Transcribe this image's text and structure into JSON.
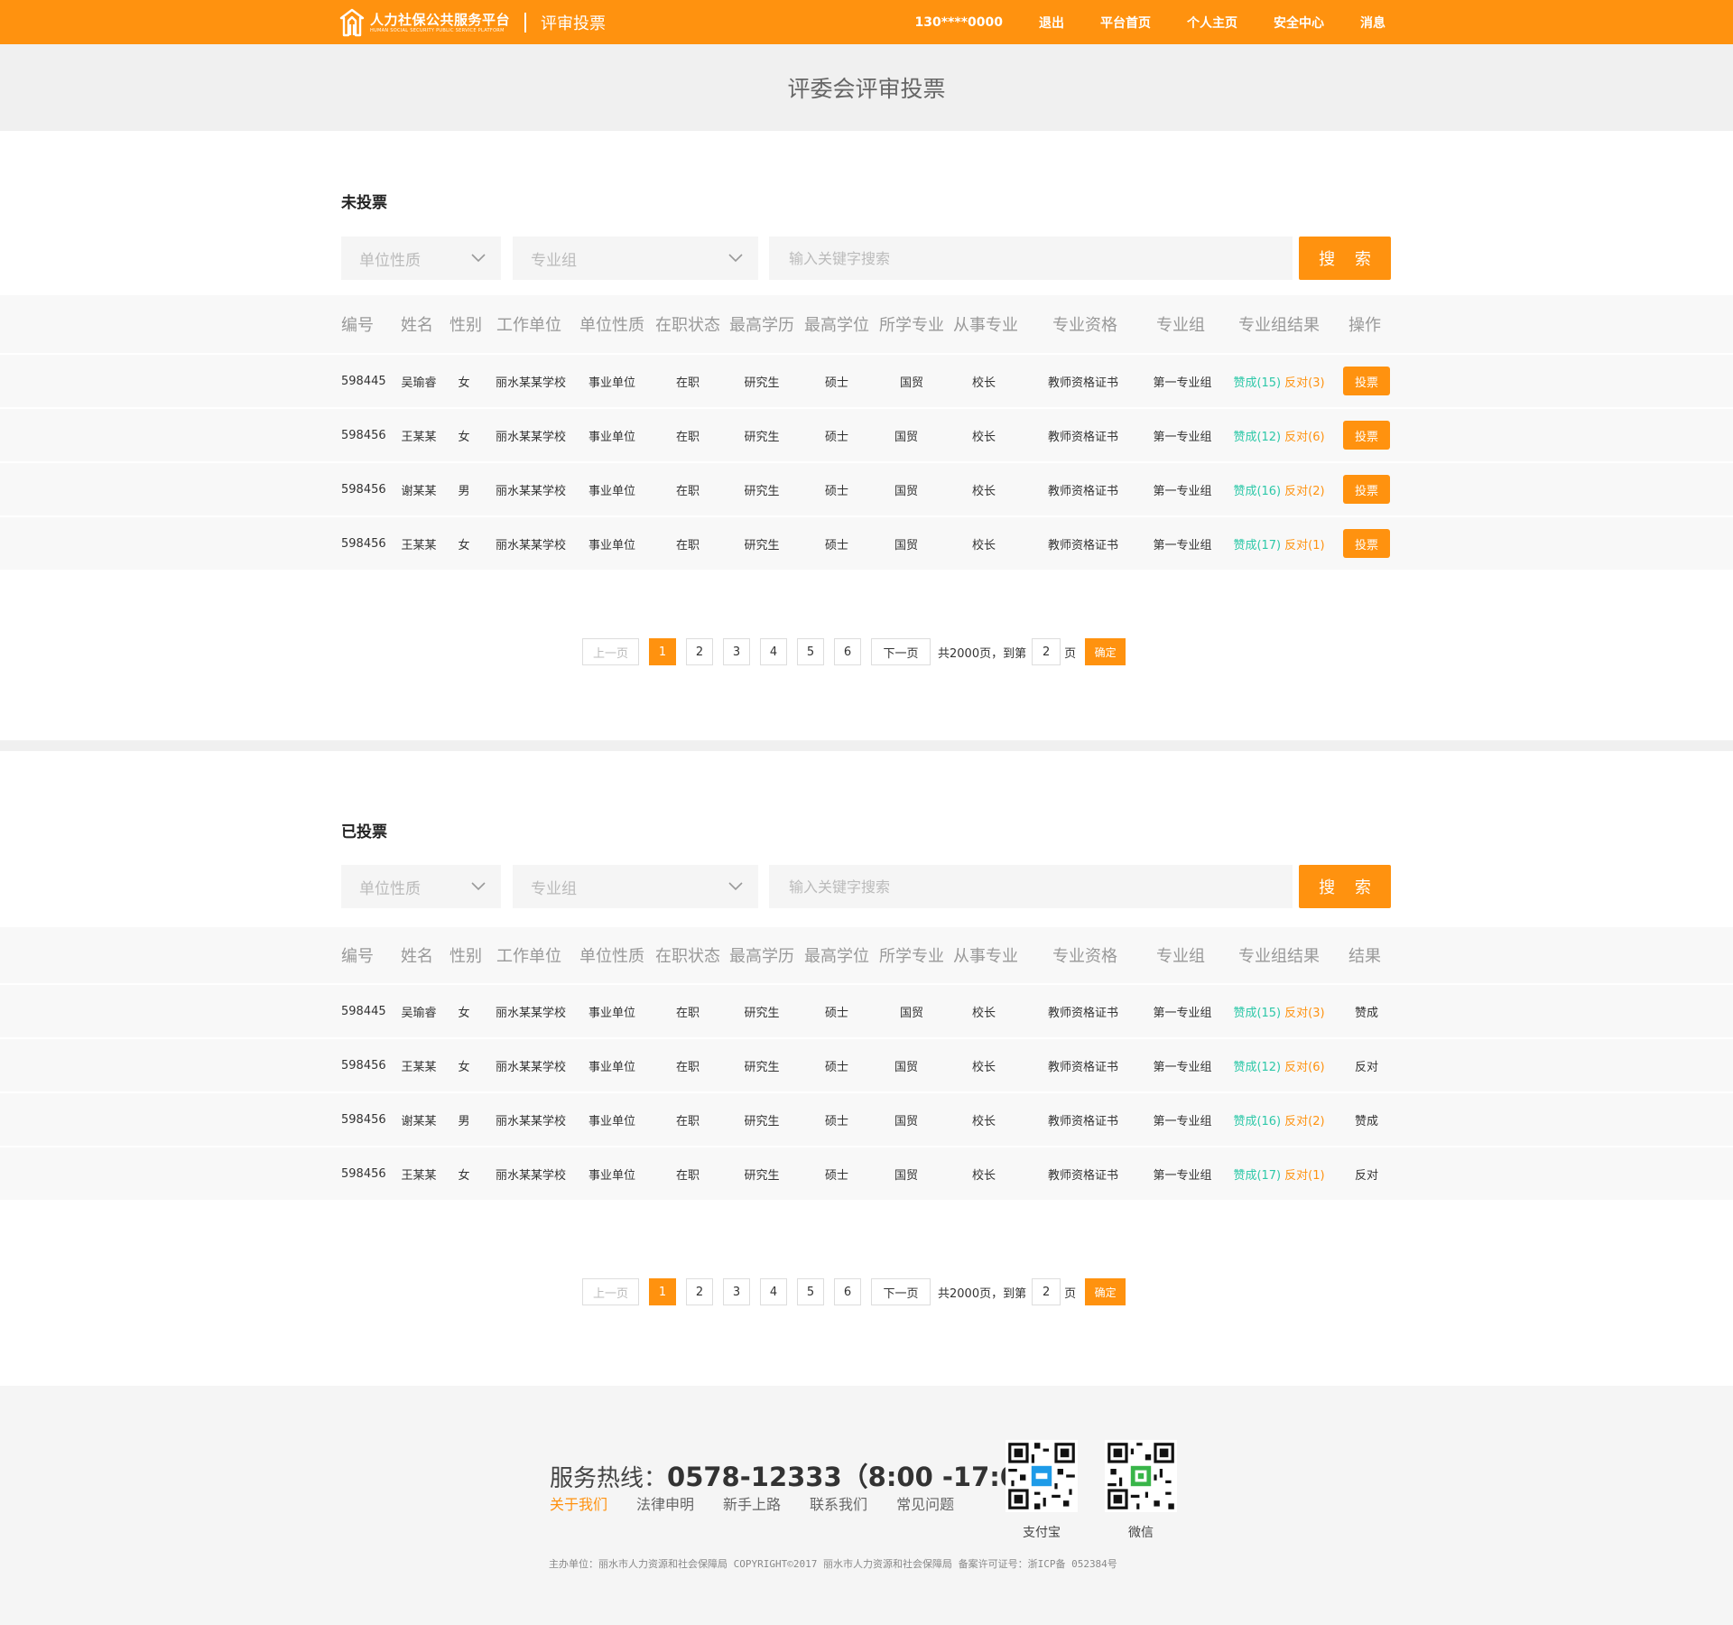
{
  "header": {
    "brand_name": "人力社保公共服务平台",
    "brand_sub": "HUMAN SOCIAL SECURITY PUBLIC SERVICE PLATFORM",
    "page_name": "评审投票",
    "nav": [
      "130****0000",
      "退出",
      "平台首页",
      "个人主页",
      "安全中心",
      "消息"
    ]
  },
  "banner": {
    "title": "评委会评审投票"
  },
  "filters": {
    "unit_type_placeholder": "单位性质",
    "group_placeholder": "专业组",
    "search_placeholder": "输入关键字搜索",
    "search_button": "搜 索"
  },
  "unvoted": {
    "title": "未投票",
    "columns": [
      "编号",
      "姓名",
      "性别",
      "工作单位",
      "单位性质",
      "在职状态",
      "最高学历",
      "最高学位",
      "所学专业",
      "从事专业",
      "专业资格",
      "专业组",
      "专业组结果",
      "操作"
    ],
    "rows": [
      {
        "id": "598445",
        "name": "吴瑜睿",
        "gender": "女",
        "unit": "丽水某某学校",
        "unit_type": "事业单位",
        "status": "在职",
        "education": "研究生",
        "degree": "硕士",
        "major": "国贸",
        "work_major": "校长",
        "qualification": "教师资格证书",
        "group": "第一专业组",
        "agree": "赞成(15)",
        "oppose": "反对(3)",
        "action": "投票"
      },
      {
        "id": "598456",
        "name": "王某某",
        "gender": "女",
        "unit": "丽水某某学校",
        "unit_type": "事业单位",
        "status": "在职",
        "education": "研究生",
        "degree": "硕士",
        "major": "国贸",
        "work_major": "校长",
        "qualification": "教师资格证书",
        "group": "第一专业组",
        "agree": "赞成(12)",
        "oppose": "反对(6)",
        "action": "投票"
      },
      {
        "id": "598456",
        "name": "谢某某",
        "gender": "男",
        "unit": "丽水某某学校",
        "unit_type": "事业单位",
        "status": "在职",
        "education": "研究生",
        "degree": "硕士",
        "major": "国贸",
        "work_major": "校长",
        "qualification": "教师资格证书",
        "group": "第一专业组",
        "agree": "赞成(16)",
        "oppose": "反对(2)",
        "action": "投票"
      },
      {
        "id": "598456",
        "name": "王某某",
        "gender": "女",
        "unit": "丽水某某学校",
        "unit_type": "事业单位",
        "status": "在职",
        "education": "研究生",
        "degree": "硕士",
        "major": "国贸",
        "work_major": "校长",
        "qualification": "教师资格证书",
        "group": "第一专业组",
        "agree": "赞成(17)",
        "oppose": "反对(1)",
        "action": "投票"
      }
    ]
  },
  "voted": {
    "title": "已投票",
    "columns": [
      "编号",
      "姓名",
      "性别",
      "工作单位",
      "单位性质",
      "在职状态",
      "最高学历",
      "最高学位",
      "所学专业",
      "从事专业",
      "专业资格",
      "专业组",
      "专业组结果",
      "结果"
    ],
    "rows": [
      {
        "id": "598445",
        "name": "吴瑜睿",
        "gender": "女",
        "unit": "丽水某某学校",
        "unit_type": "事业单位",
        "status": "在职",
        "education": "研究生",
        "degree": "硕士",
        "major": "国贸",
        "work_major": "校长",
        "qualification": "教师资格证书",
        "group": "第一专业组",
        "agree": "赞成(15)",
        "oppose": "反对(3)",
        "result": "赞成"
      },
      {
        "id": "598456",
        "name": "王某某",
        "gender": "女",
        "unit": "丽水某某学校",
        "unit_type": "事业单位",
        "status": "在职",
        "education": "研究生",
        "degree": "硕士",
        "major": "国贸",
        "work_major": "校长",
        "qualification": "教师资格证书",
        "group": "第一专业组",
        "agree": "赞成(12)",
        "oppose": "反对(6)",
        "result": "反对"
      },
      {
        "id": "598456",
        "name": "谢某某",
        "gender": "男",
        "unit": "丽水某某学校",
        "unit_type": "事业单位",
        "status": "在职",
        "education": "研究生",
        "degree": "硕士",
        "major": "国贸",
        "work_major": "校长",
        "qualification": "教师资格证书",
        "group": "第一专业组",
        "agree": "赞成(16)",
        "oppose": "反对(2)",
        "result": "赞成"
      },
      {
        "id": "598456",
        "name": "王某某",
        "gender": "女",
        "unit": "丽水某某学校",
        "unit_type": "事业单位",
        "status": "在职",
        "education": "研究生",
        "degree": "硕士",
        "major": "国贸",
        "work_major": "校长",
        "qualification": "教师资格证书",
        "group": "第一专业组",
        "agree": "赞成(17)",
        "oppose": "反对(1)",
        "result": "反对"
      }
    ]
  },
  "pagination": {
    "prev": "上一页",
    "pages": [
      "1",
      "2",
      "3",
      "4",
      "5",
      "6"
    ],
    "current": "1",
    "next": "下一页",
    "total": "共2000页，到第",
    "goto_value": "2",
    "unit": "页",
    "confirm": "确定"
  },
  "footer": {
    "hotline_label": "服务热线：",
    "hotline_number": "0578-12333（8:00 -17:00）",
    "links": [
      "关于我们",
      "法律申明",
      "新手上路",
      "联系我们",
      "常见问题"
    ],
    "qr_alipay": "支付宝",
    "qr_wechat": "微信",
    "copyright": "主办单位：丽水市人力资源和社会保障局  COPYRIGHT©2017  丽水市人力资源和社会保障局  备案许可证号：浙ICP备 052384号"
  },
  "colors": {
    "accent": "#ff920f",
    "agree": "#2dc8a8",
    "banner_bg": "#f0f0f0",
    "row_bg": "#f8f8f8"
  }
}
